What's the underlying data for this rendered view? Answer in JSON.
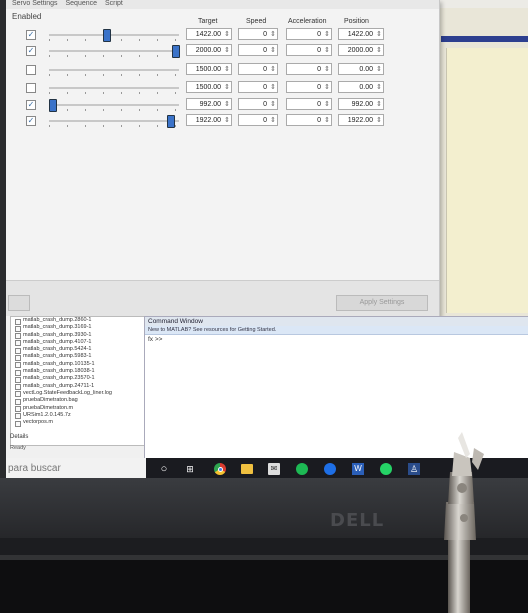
{
  "menu": {
    "items": [
      "Servo Settings",
      "Sequence",
      "Script"
    ]
  },
  "servos": {
    "enabled_label": "Enabled",
    "headers": {
      "target": "Target",
      "speed": "Speed",
      "acceleration": "Acceleration",
      "position": "Position"
    },
    "rows": [
      {
        "enabled": true,
        "slider_fraction": 0.43,
        "target": "1422.00",
        "speed": "0",
        "acceleration": "0",
        "position": "1422.00"
      },
      {
        "enabled": true,
        "slider_fraction": 0.98,
        "target": "2000.00",
        "speed": "0",
        "acceleration": "0",
        "position": "2000.00"
      },
      {
        "enabled": false,
        "slider_fraction": 0.0,
        "target": "1500.00",
        "speed": "0",
        "acceleration": "0",
        "position": "0.00"
      },
      {
        "enabled": false,
        "slider_fraction": 0.0,
        "target": "1500.00",
        "speed": "0",
        "acceleration": "0",
        "position": "0.00"
      },
      {
        "enabled": true,
        "slider_fraction": 0.0,
        "target": "992.00",
        "speed": "0",
        "acceleration": "0",
        "position": "992.00"
      },
      {
        "enabled": true,
        "slider_fraction": 0.94,
        "target": "1922.00",
        "speed": "0",
        "acceleration": "0",
        "position": "1922.00"
      }
    ],
    "apply_label": "Apply Settings"
  },
  "files": {
    "items": [
      "matlab_crash_dump.2860-1",
      "matlab_crash_dump.3169-1",
      "matlab_crash_dump.3930-1",
      "matlab_crash_dump.4107-1",
      "matlab_crash_dump.5424-1",
      "matlab_crash_dump.5983-1",
      "matlab_crash_dump.10135-1",
      "matlab_crash_dump.18038-1",
      "matlab_crash_dump.23570-1",
      "matlab_crash_dump.24711-1",
      "vectLog.StateFeedbackLog_liner.log",
      "pruebaDimetraton.bag",
      "pruebaDimetraton.m",
      "URSim1.2.0.145.7z",
      "vectorpos.m"
    ],
    "details_label": "Details",
    "status": "Ready"
  },
  "command_window": {
    "title": "Command Window",
    "banner": "New to MATLAB? See resources for Getting Started.",
    "prompt": "fx >>"
  },
  "taskbar": {
    "search_placeholder": "para buscar",
    "icons": [
      "cortana-icon",
      "task-view-icon",
      "chrome-icon",
      "file-explorer-icon",
      "mail-icon",
      "spotify-icon",
      "blue-app-icon",
      "word-icon",
      "whatsapp-icon",
      "maestro-icon"
    ]
  },
  "bezel": {
    "brand": "DELL"
  }
}
